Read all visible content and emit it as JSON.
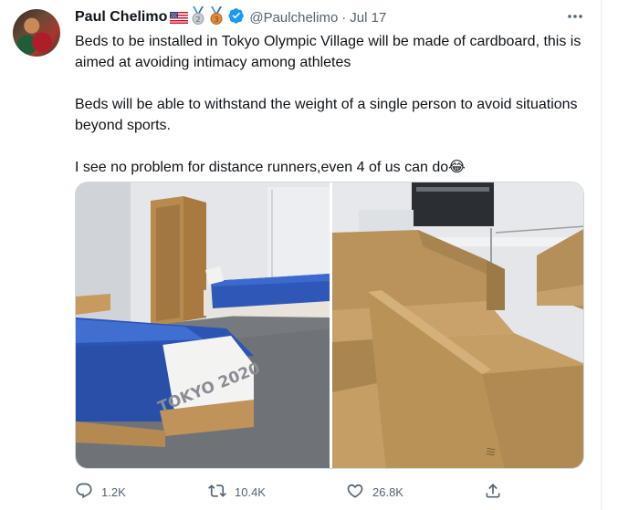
{
  "tweet": {
    "author_name": "Paul Chelimo",
    "handle": "@Paulchelimo",
    "separator": "·",
    "date": "Jul 17",
    "medals": [
      "2",
      "3"
    ],
    "paragraphs": [
      "Beds to be installed in Tokyo Olympic Village will be made of cardboard, this is aimed at avoiding intimacy among athletes",
      "Beds will be able to withstand the weight of a single person to avoid situations beyond sports.",
      "I see no problem for distance runners,even 4 of us can do😂"
    ],
    "images": [
      {
        "name": "room-with-beds",
        "duvet_text": "TOKYO 2020"
      },
      {
        "name": "cardboard-bed-frame"
      }
    ],
    "actions": {
      "reply_count": "1.2K",
      "retweet_count": "10.4K",
      "like_count": "26.8K"
    },
    "icons": [
      "flag-us-icon",
      "silver-medal-icon",
      "bronze-medal-icon",
      "verified-badge-icon",
      "more-options-icon",
      "reply-icon",
      "retweet-icon",
      "like-icon",
      "share-icon"
    ]
  },
  "colors": {
    "text": "#0f1419",
    "secondary_text": "#536471",
    "verified_blue": "#1d9bf0",
    "divider": "#e6ecf0"
  }
}
